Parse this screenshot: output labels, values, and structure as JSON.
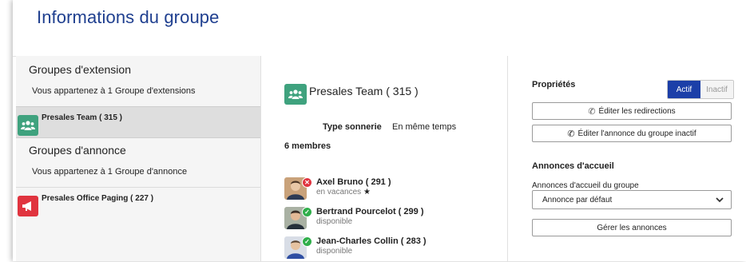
{
  "page": {
    "title": "Informations du groupe"
  },
  "extension_groups": {
    "title": "Groupes d'extension",
    "subtitle": "Vous appartenez à 1 Groupe d'extensions",
    "items": [
      {
        "label": "Presales Team ( 315 )",
        "color": "#3fa27e",
        "icon": "team-icon",
        "selected": true
      }
    ]
  },
  "announce_groups": {
    "title": "Groupes d'annonce",
    "subtitle": "Vous appartenez à 1 Groupe d'annonce",
    "items": [
      {
        "label": "Presales Office Paging ( 227 )",
        "color": "#e0343f",
        "icon": "megaphone-icon",
        "selected": false
      }
    ]
  },
  "detail": {
    "title": "Presales Team ( 315 )",
    "ring_label": "Type sonnerie",
    "ring_value": "En même temps",
    "members_count": "6 membres",
    "members": [
      {
        "name": "Axel Bruno ( 291 )",
        "status": "en vacances",
        "status_color": "#e0343f",
        "status_icon": "close-icon",
        "extra_icon": "star-icon"
      },
      {
        "name": "Bertrand Pourcelot ( 299 )",
        "status": "disponible",
        "status_color": "#2fae4a",
        "status_icon": "check-icon"
      },
      {
        "name": "Jean-Charles Collin ( 283 )",
        "status": "disponible",
        "status_color": "#2fae4a",
        "status_icon": "check-icon"
      }
    ]
  },
  "properties": {
    "title": "Propriétés",
    "toggle_on": "Actif",
    "toggle_off": "Inactif",
    "edit_redirections": "Éditer les redirections",
    "edit_inactive_announce": "Éditer l'annonce du groupe inactif"
  },
  "welcome": {
    "title": "Annonces d'accueil",
    "field_label": "Annonces d'accueil du groupe",
    "selected": "Annonce par défaut",
    "manage": "Gérer les annonces"
  },
  "colors": {
    "accent": "#1c3fa8",
    "title": "#1f3f8f",
    "team": "#3fa27e",
    "paging": "#e0343f"
  }
}
